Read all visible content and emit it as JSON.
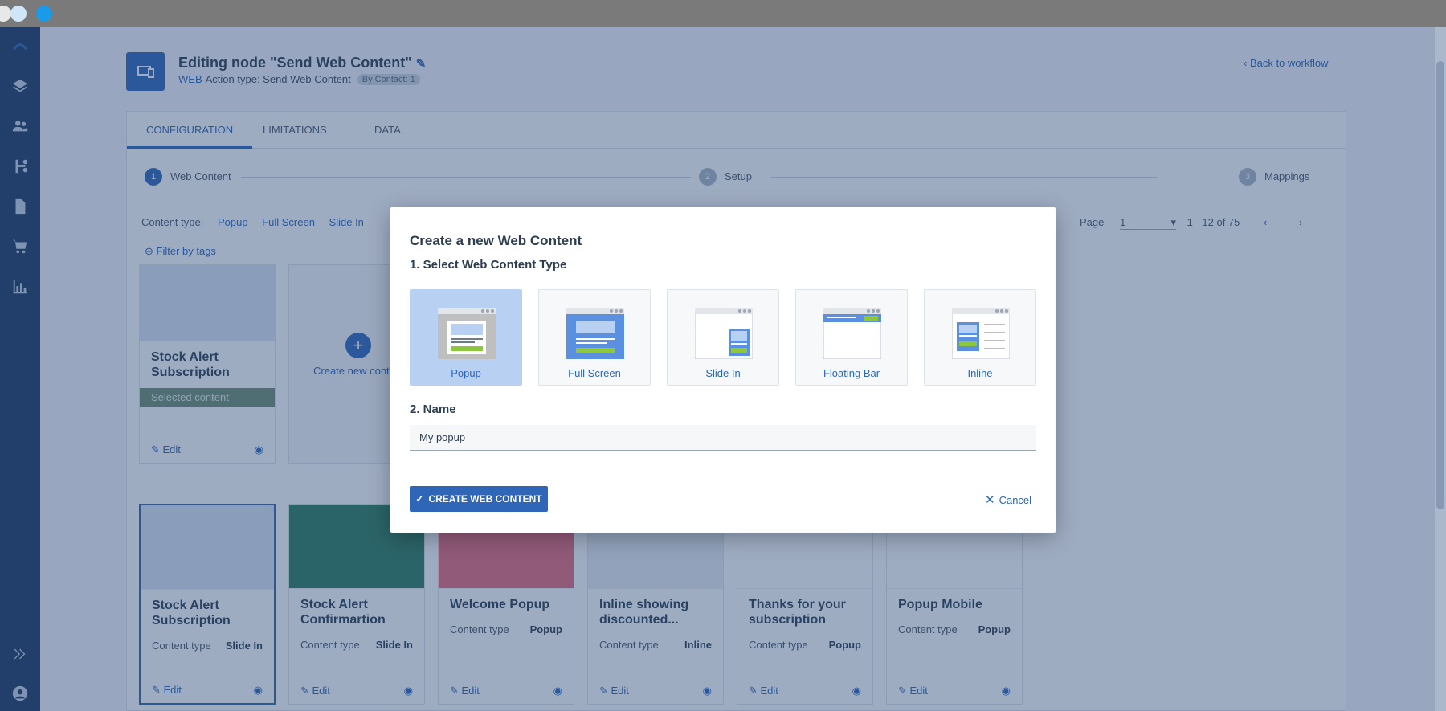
{
  "header": {
    "title": "Editing node \"Send Web Content\"",
    "channel": "WEB",
    "action_type": "Action type: Send Web Content",
    "badge": "By Contact: 1",
    "back_link": "Back to workflow"
  },
  "tabs": [
    "CONFIGURATION",
    "LIMITATIONS",
    "DATA"
  ],
  "stepper": [
    {
      "num": "1",
      "label": "Web Content"
    },
    {
      "num": "2",
      "label": "Setup"
    },
    {
      "num": "3",
      "label": "Mappings"
    }
  ],
  "filters": {
    "content_type_label": "Content type:",
    "types": [
      "Popup",
      "Full Screen",
      "Slide In"
    ],
    "filter_by_tags": "Filter by tags",
    "page_label": "Page",
    "page_value": "1",
    "range": "1 - 12 of 75"
  },
  "cards_row1": {
    "stock_alert": {
      "name": "Stock Alert Subscription",
      "status": "Selected content",
      "edit": "Edit"
    },
    "create_new": "Create new cont"
  },
  "cards_row2": [
    {
      "name": "Stock Alert Subscription",
      "meta_label": "Content type",
      "meta_value": "Slide In",
      "edit": "Edit"
    },
    {
      "name": "Stock Alert Confirmartion",
      "meta_label": "Content type",
      "meta_value": "Slide In",
      "edit": "Edit"
    },
    {
      "name": "Welcome Popup",
      "meta_label": "Content type",
      "meta_value": "Popup",
      "edit": "Edit"
    },
    {
      "name": "Inline showing discounted...",
      "meta_label": "Content type",
      "meta_value": "Inline",
      "edit": "Edit"
    },
    {
      "name": "Thanks for your subscription",
      "meta_label": "Content type",
      "meta_value": "Popup",
      "edit": "Edit"
    },
    {
      "name": "Popup Mobile",
      "meta_label": "Content type",
      "meta_value": "Popup",
      "edit": "Edit"
    }
  ],
  "modal": {
    "title": "Create a new Web Content",
    "step1": "1. Select Web Content Type",
    "types": [
      "Popup",
      "Full Screen",
      "Slide In",
      "Floating Bar",
      "Inline"
    ],
    "selected_type": "Popup",
    "step2": "2. Name",
    "name_value": "My popup",
    "create_button": "CREATE WEB CONTENT",
    "cancel_button": "Cancel"
  },
  "colors": {
    "brand": "#2f66b8",
    "sidebar": "#1d3a5f",
    "selected_type_bg": "#b8d0f2"
  }
}
